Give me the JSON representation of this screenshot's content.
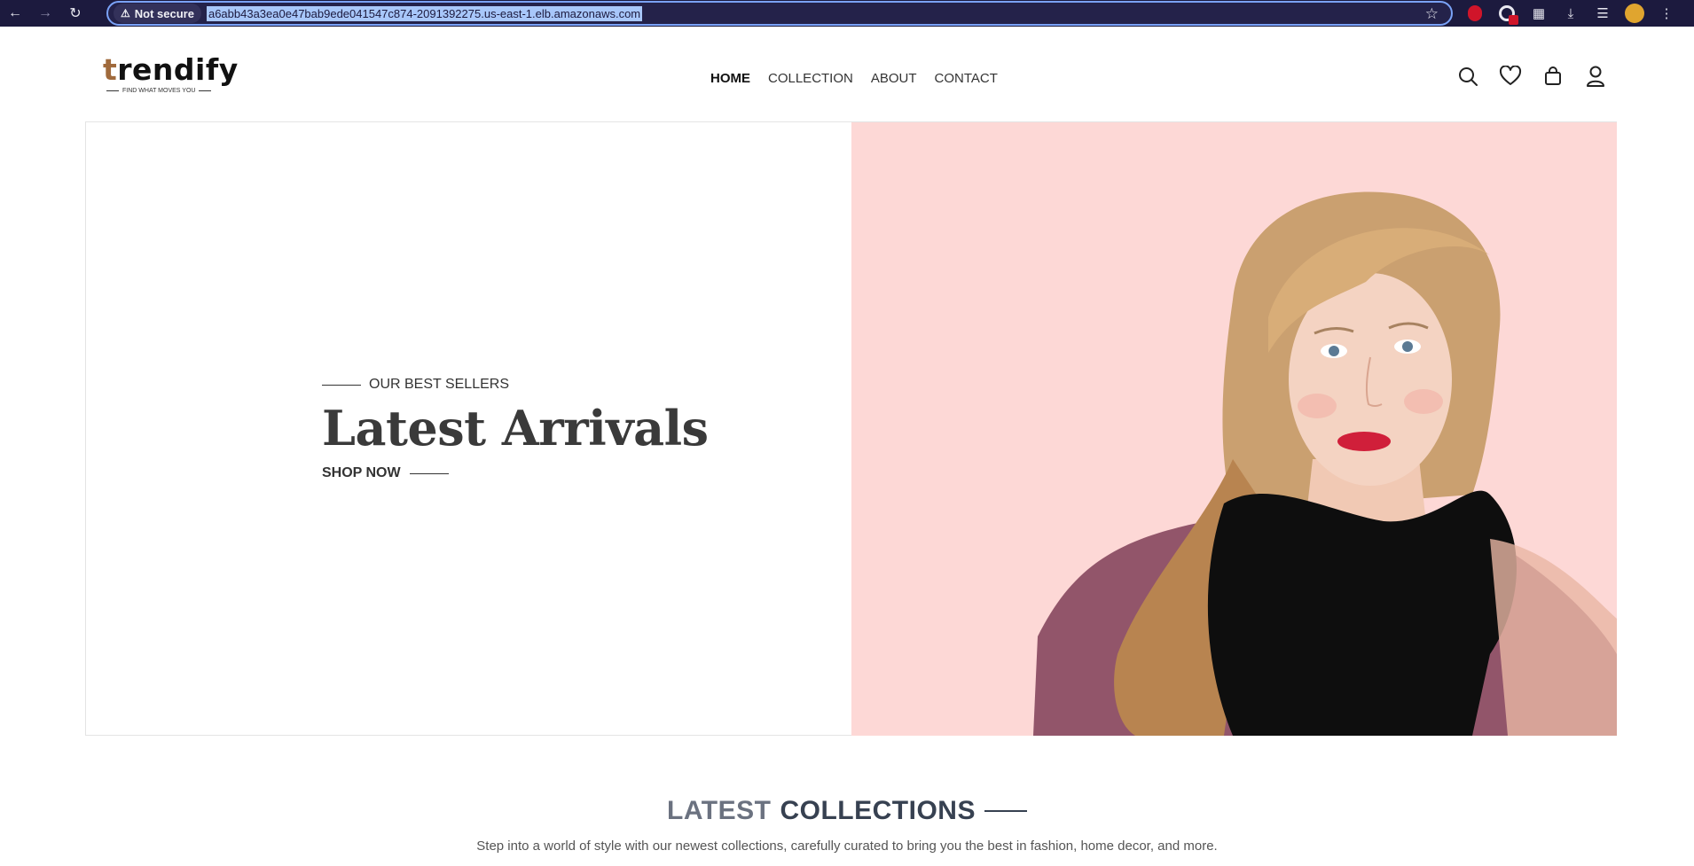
{
  "browser": {
    "security_label": "Not secure",
    "url": "a6abb43a3ea0e47bab9ede041547c874-2091392275.us-east-1.elb.amazonaws.com"
  },
  "site": {
    "logo_text_start": "t",
    "logo_text_rest": "rendify",
    "logo_tagline": "FIND WHAT MOVES YOU",
    "nav": [
      "HOME",
      "COLLECTION",
      "ABOUT",
      "CONTACT"
    ],
    "icons": [
      "search-icon",
      "heart-icon",
      "bag-icon",
      "user-icon"
    ]
  },
  "hero": {
    "eyebrow": "OUR BEST SELLERS",
    "title": "Latest Arrivals",
    "cta": "SHOP NOW",
    "image_bg": "#fdd8d6"
  },
  "collections": {
    "title_part1": "LATEST",
    "title_part2": "COLLECTIONS",
    "subtitle": "Step into a world of style with our newest collections, carefully curated to bring you the best in fashion, home decor, and more."
  }
}
